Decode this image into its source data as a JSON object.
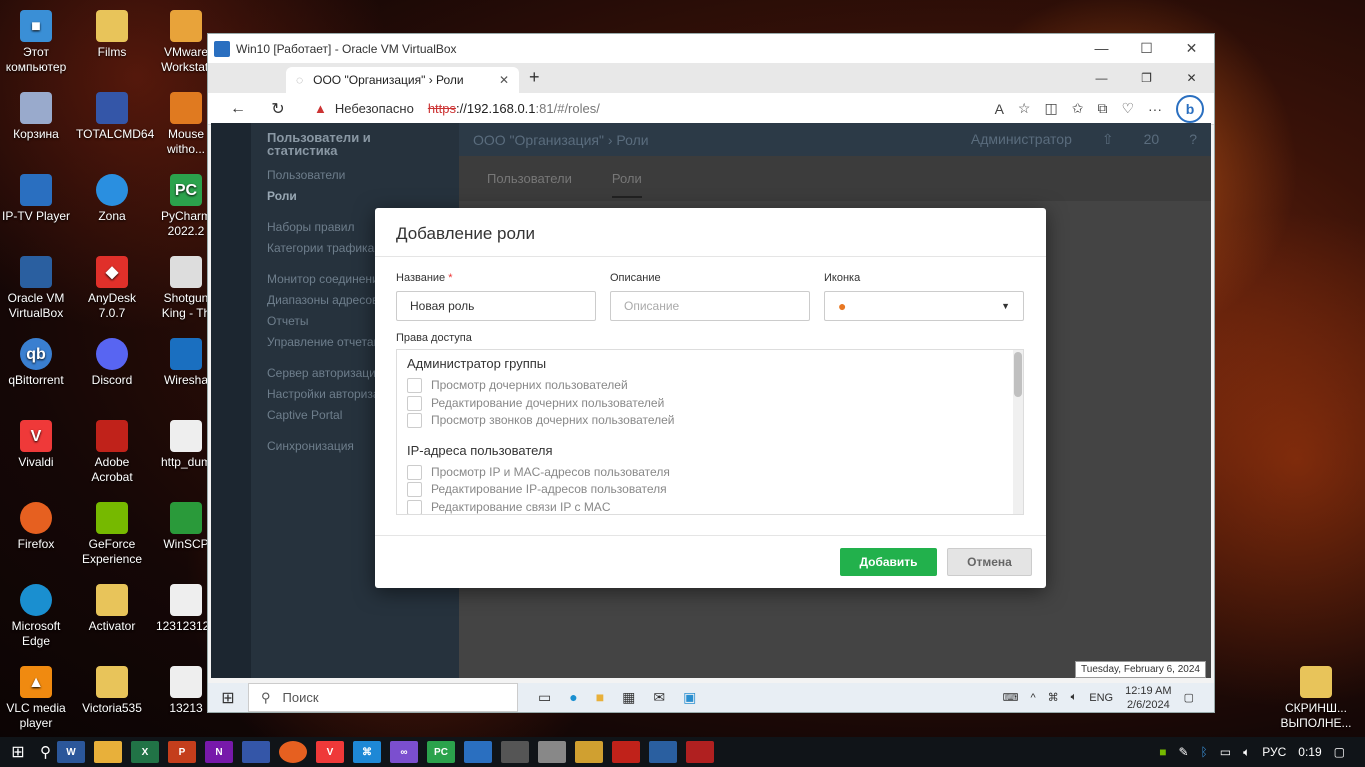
{
  "desktop": {
    "icons": [
      {
        "label1": "Этот",
        "label2": "компьютер",
        "color": "#3a8fd6"
      },
      {
        "label1": "Films",
        "label2": "",
        "color": "#e8c45a"
      },
      {
        "label1": "VMware",
        "label2": "Workstati",
        "color": "#e8a33a"
      },
      {
        "label1": "Корзина",
        "label2": "",
        "color": "#9ac"
      },
      {
        "label1": "TOTALCMD64",
        "label2": "",
        "color": "#3456a8"
      },
      {
        "label1": "Mouse",
        "label2": "witho...",
        "color": "#e07a20"
      },
      {
        "label1": "IP-TV Player",
        "label2": "",
        "color": "#2a6fc0"
      },
      {
        "label1": "Zona",
        "label2": "",
        "color": "#2a8fe0"
      },
      {
        "label1": "PyCharm",
        "label2": "2022.2",
        "color": "#2ba24c"
      },
      {
        "label1": "Oracle VM",
        "label2": "VirtualBox",
        "color": "#2a5fa0"
      },
      {
        "label1": "AnyDesk",
        "label2": "7.0.7",
        "color": "#e0302a"
      },
      {
        "label1": "Shotgun",
        "label2": "King - Th",
        "color": "#ddd"
      },
      {
        "label1": "qBittorrent",
        "label2": "",
        "color": "#3a7fd0"
      },
      {
        "label1": "Discord",
        "label2": "",
        "color": "#5865f2"
      },
      {
        "label1": "Wiresha",
        "label2": "",
        "color": "#1a6fc0"
      },
      {
        "label1": "Vivaldi",
        "label2": "",
        "color": "#ef3939"
      },
      {
        "label1": "Adobe",
        "label2": "Acrobat",
        "color": "#c0221a"
      },
      {
        "label1": "http_dum",
        "label2": "",
        "color": "#eee"
      },
      {
        "label1": "Firefox",
        "label2": "",
        "color": "#e66020"
      },
      {
        "label1": "GeForce",
        "label2": "Experience",
        "color": "#76b900"
      },
      {
        "label1": "WinSCP",
        "label2": "",
        "color": "#2a9a3a"
      },
      {
        "label1": "Microsoft",
        "label2": "Edge",
        "color": "#1a8fd0"
      },
      {
        "label1": "Activator",
        "label2": "",
        "color": "#e8c45a"
      },
      {
        "label1": "123123123",
        "label2": "",
        "color": "#eee"
      },
      {
        "label1": "VLC media",
        "label2": "player",
        "color": "#f08a10"
      },
      {
        "label1": "Victoria535",
        "label2": "",
        "color": "#e8c45a"
      },
      {
        "label1": "13213",
        "label2": "",
        "color": "#eee"
      },
      {
        "label1": "СКРИНШ...",
        "label2": "ВЫПОЛНЕ...",
        "color": "#e8c45a"
      }
    ]
  },
  "vbox": {
    "title": "Win10 [Работает] - Oracle VM VirtualBox"
  },
  "browser": {
    "tab_title": "ООО \"Организация\" › Роли",
    "insecure": "Небезопасно",
    "url_scheme": "https",
    "url_host": "://192.168.0.1",
    "url_rest": ":81/#/roles/"
  },
  "app": {
    "sidenav_title": "Пользователи и статистика",
    "sidenav_items": [
      "Пользователи",
      "Роли",
      "Наборы правил",
      "Категории трафика",
      "Монитор соединений",
      "Диапазоны адресов",
      "Отчеты",
      "Управление отчетами",
      "Сервер авторизации",
      "Настройки авторизации",
      "Captive Portal",
      "Синхронизация"
    ],
    "breadcrumb": "ООО \"Организация\" › Роли",
    "user": "Администратор",
    "count": "20",
    "tabs": [
      "Пользователи",
      "Роли"
    ]
  },
  "modal": {
    "title": "Добавление роли",
    "name_label": "Название",
    "name_value": "Новая роль",
    "desc_label": "Описание",
    "desc_placeholder": "Описание",
    "icon_label": "Иконка",
    "perms_label": "Права доступа",
    "groups": [
      {
        "title": "Администратор группы",
        "items": [
          "Просмотр дочерних пользователей",
          "Редактирование дочерних пользователей",
          "Просмотр звонков дочерних пользователей"
        ]
      },
      {
        "title": "IP-адреса пользователя",
        "items": [
          "Просмотр IP и MAC-адресов пользователя",
          "Редактирование IP-адресов пользователя",
          "Редактирование связи IP с MAC"
        ]
      }
    ],
    "ok": "Добавить",
    "cancel": "Отмена"
  },
  "vmtaskbar": {
    "search": "Поиск",
    "lang": "ENG",
    "time": "12:19 AM",
    "date": "2/6/2024",
    "tooltip": "Tuesday, February 6, 2024"
  },
  "hosttaskbar": {
    "lang": "РУС",
    "time": "0:19"
  }
}
